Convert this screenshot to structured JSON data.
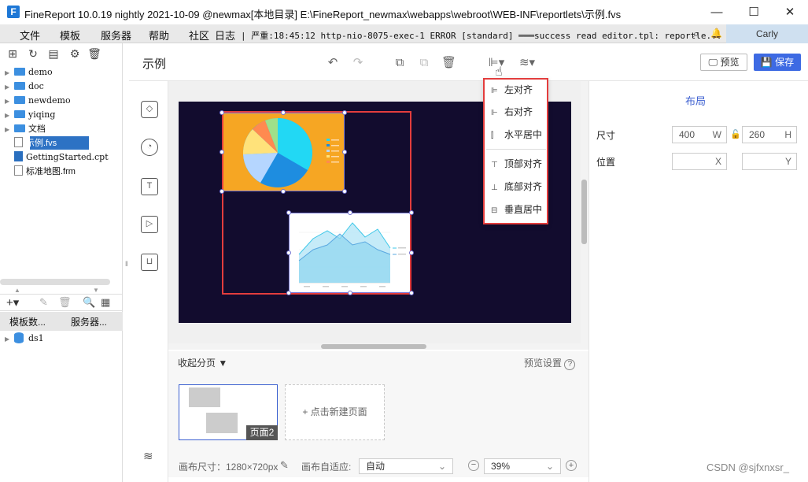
{
  "window": {
    "title": "FineReport 10.0.19 nightly 2021-10-09 @newmax[本地目录]    E:\\FineReport_newmax\\webapps\\webroot\\WEB-INF\\reportlets\\示例.fvs",
    "logo": "F",
    "controls": {
      "minimize": "—",
      "maximize": "☐",
      "close": "✕"
    }
  },
  "menubar": {
    "items": [
      "文件",
      "模板",
      "服务器",
      "帮助",
      "社区",
      "日志"
    ],
    "log": "| 严重:18:45:12 http-nio-8075-exec-1 ERROR [standard] ═══success read editor.tpl: reportle...",
    "user": "Carly"
  },
  "left_panel": {
    "tree": [
      {
        "label": "demo",
        "kind": "folder"
      },
      {
        "label": "doc",
        "kind": "folder"
      },
      {
        "label": "newdemo",
        "kind": "folder"
      },
      {
        "label": "yiqing",
        "kind": "folder"
      },
      {
        "label": "文档",
        "kind": "folder"
      },
      {
        "label": "示例.fvs",
        "kind": "file",
        "selected": true
      },
      {
        "label": "GettingStarted.cpt",
        "kind": "cpt"
      },
      {
        "label": "标准地图.frm",
        "kind": "file"
      }
    ],
    "tabs": [
      "模板数...",
      "服务器..."
    ],
    "datasource": "ds1"
  },
  "editor": {
    "title": "示例",
    "preview_label": "预览",
    "save_label": "保存"
  },
  "align_menu": {
    "items": [
      "左对齐",
      "右对齐",
      "水平居中",
      "顶部对齐",
      "底部对齐",
      "垂直居中"
    ]
  },
  "pages": {
    "collapse_label": "收起分页",
    "preview_settings": "预览设置",
    "thumb_label": "页面2",
    "new_page": "+ 点击新建页面"
  },
  "statusbar": {
    "canvas_size": "画布尺寸：1280×720px",
    "adapt_label": "画布自适应:",
    "adapt_value": "自动",
    "zoom_value": "39%"
  },
  "properties": {
    "title": "布局",
    "size_label": "尺寸",
    "width_value": "400",
    "width_unit": "W",
    "height_value": "260",
    "height_unit": "H",
    "position_label": "位置",
    "x_unit": "X",
    "y_unit": "Y"
  },
  "watermark": "CSDN @sjfxnxsr_"
}
